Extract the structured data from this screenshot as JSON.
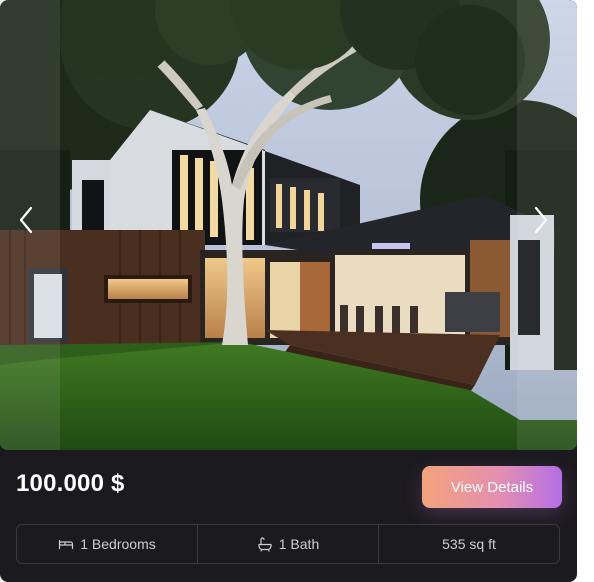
{
  "listing": {
    "price": "100.000 $",
    "cta_label": "View Details",
    "specs": [
      {
        "label": "1 Bedrooms",
        "icon": "bed-icon"
      },
      {
        "label": "1 Bath",
        "icon": "bathtub-icon"
      },
      {
        "label": "535 sq ft",
        "icon": ""
      }
    ]
  },
  "carousel": {
    "prev_icon": "chevron-left-icon",
    "next_icon": "chevron-right-icon"
  },
  "colors": {
    "card_bg": "#1b1a1f",
    "text_primary": "#ffffff",
    "text_secondary": "#cfcdd4",
    "border": "#3b3a41",
    "cta_gradient_start": "#f3a37c",
    "cta_gradient_end": "#b46fe6"
  }
}
